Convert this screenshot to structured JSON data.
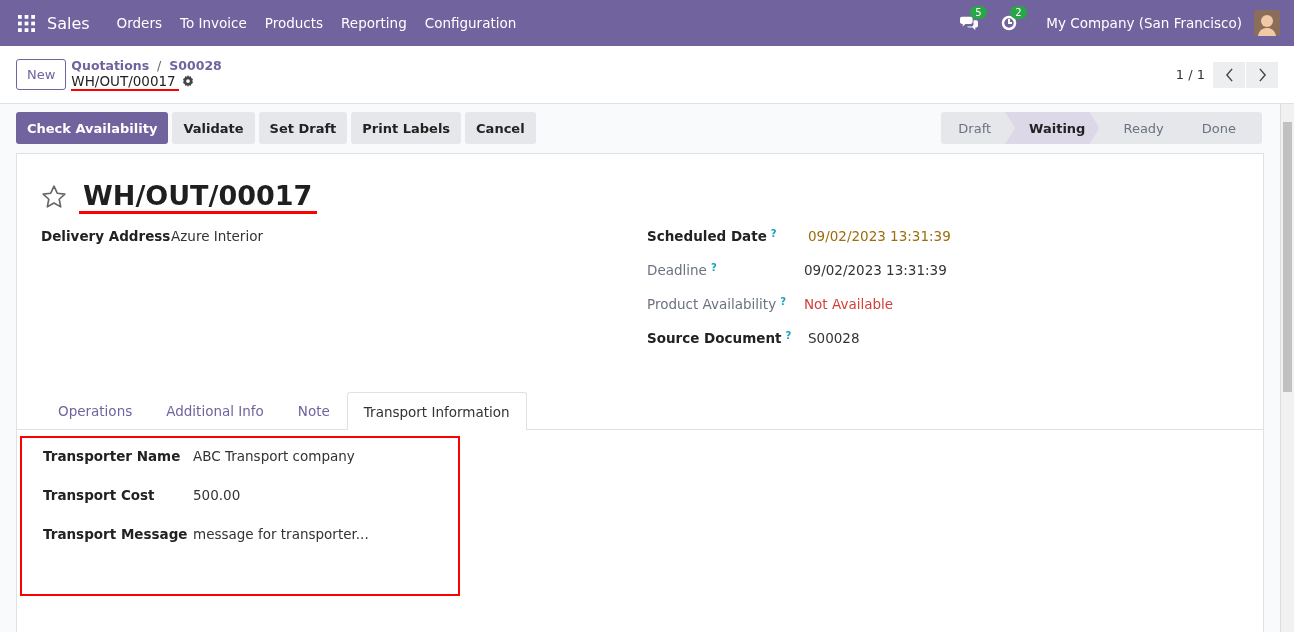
{
  "navbar": {
    "app": "Sales",
    "menu": [
      "Orders",
      "To Invoice",
      "Products",
      "Reporting",
      "Configuration"
    ],
    "messages_count": "5",
    "activities_count": "2",
    "company": "My Company (San Francisco)"
  },
  "control_panel": {
    "new_button": "New",
    "breadcrumb": [
      "Quotations",
      "S00028"
    ],
    "breadcrumb_separator": "/",
    "record": "WH/OUT/00017",
    "pager": "1 / 1"
  },
  "actions": [
    {
      "label": "Check Availability",
      "primary": true
    },
    {
      "label": "Validate",
      "primary": false
    },
    {
      "label": "Set Draft",
      "primary": false
    },
    {
      "label": "Print Labels",
      "primary": false
    },
    {
      "label": "Cancel",
      "primary": false
    }
  ],
  "stages": [
    {
      "label": "Draft",
      "selected": false
    },
    {
      "label": "Waiting",
      "selected": true
    },
    {
      "label": "Ready",
      "selected": false
    },
    {
      "label": "Done",
      "selected": false
    }
  ],
  "form": {
    "title": "WH/OUT/00017",
    "starred": false,
    "left_fields": [
      {
        "label": "Delivery Address",
        "value": "Azure Interior"
      }
    ],
    "right_fields": [
      {
        "label": "Scheduled Date",
        "help": "?",
        "value": "09/02/2023 13:31:39",
        "required": true,
        "color": "#9c6d0d"
      },
      {
        "label": "Deadline",
        "help": "?",
        "value": "09/02/2023 13:31:39",
        "required": false,
        "color": "#333333"
      },
      {
        "label": "Product Availability",
        "help": "?",
        "value": "Not Available",
        "required": false,
        "color": "#d23f3a"
      },
      {
        "label": "Source Document",
        "help": "?",
        "value": "S00028",
        "required": true,
        "color": "#333333"
      }
    ],
    "tabs": [
      {
        "label": "Operations",
        "selected": false
      },
      {
        "label": "Additional Info",
        "selected": false
      },
      {
        "label": "Note",
        "selected": false
      },
      {
        "label": "Transport Information",
        "selected": true
      }
    ],
    "transport_fields": [
      {
        "label": "Transporter Name",
        "value": "ABC Transport company"
      },
      {
        "label": "Transport Cost",
        "value": "500.00"
      },
      {
        "label": "Transport Message",
        "value": "message for transporter..."
      }
    ]
  }
}
